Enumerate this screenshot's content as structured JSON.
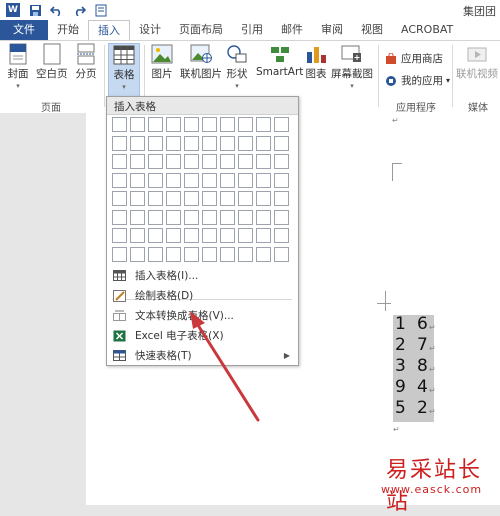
{
  "app": {
    "doc_title": "集团团",
    "qat": {
      "logo": "W",
      "save": "save-icon",
      "undo": "undo-icon",
      "redo": "redo-icon",
      "print": "print-icon"
    }
  },
  "tabs": [
    "文件",
    "开始",
    "插入",
    "设计",
    "页面布局",
    "引用",
    "邮件",
    "审阅",
    "视图",
    "ACROBAT"
  ],
  "ribbon": {
    "pages": {
      "cover": "封面",
      "blank": "空白页",
      "break": "分页",
      "group": "页面"
    },
    "table": {
      "label": "表格"
    },
    "illustrations": {
      "picture": "图片",
      "online_picture": "联机图片",
      "shapes": "形状",
      "smartart": "SmartArt",
      "chart": "图表",
      "screenshot": "屏幕截图"
    },
    "apps": {
      "store": "应用商店",
      "myapps": "我的应用",
      "group": "应用程序"
    },
    "media": {
      "online_video": "联机视频",
      "group": "媒体"
    }
  },
  "dropdown": {
    "header": "插入表格",
    "items": [
      {
        "label": "插入表格(I)..."
      },
      {
        "label": "绘制表格(D)"
      },
      {
        "label": "文本转换成表格(V)..."
      },
      {
        "label": "Excel 电子表格(X)"
      },
      {
        "label": "快速表格(T)"
      }
    ]
  },
  "document": {
    "para_mark": "↵",
    "rows": [
      {
        "a": "1",
        "b": "6"
      },
      {
        "a": "2",
        "b": "7"
      },
      {
        "a": "3",
        "b": "8"
      },
      {
        "a": "9",
        "b": "4"
      },
      {
        "a": "5",
        "b": "2"
      }
    ]
  },
  "watermark": {
    "text": "易采站长站",
    "url": "www.easck.com"
  },
  "colors": {
    "accent": "#2b579a",
    "annotation_arrow": "#c9383b",
    "watermark": "#cc1f1f"
  }
}
